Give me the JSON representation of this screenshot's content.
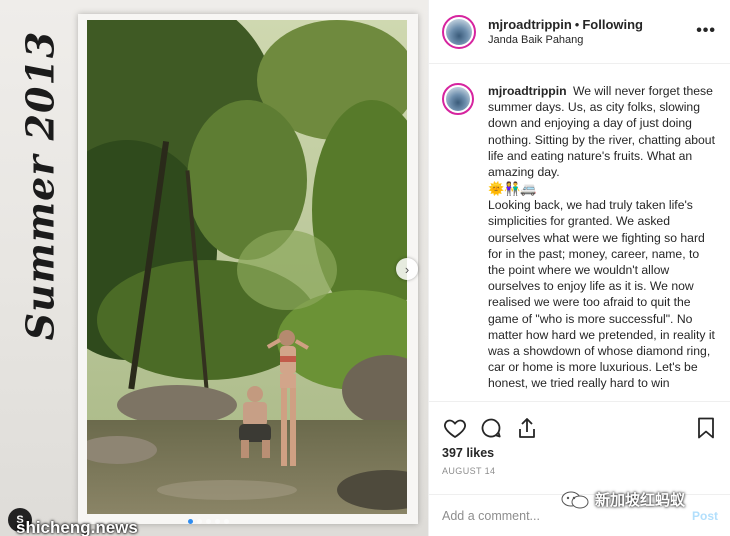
{
  "photo": {
    "handwriting": "Summer 2013",
    "carousel_dots": 5,
    "active_dot": 0,
    "watermark_logo": "S",
    "watermark_text": "shicheng.news"
  },
  "header": {
    "username": "mjroadtrippin",
    "separator": "•",
    "follow_status": "Following",
    "location": "Janda Baik Pahang",
    "more_icon": "more-horizontal-icon"
  },
  "caption": {
    "username": "mjroadtrippin",
    "text_part1": "We will never forget these summer days. Us, as city folks, slowing down and enjoying a day of just doing nothing. Sitting by the river, chatting about life and eating nature's fruits. What an amazing day.",
    "emojis": "🌞👫🚐",
    "text_part2": "Looking back, we had truly taken life's simplicities for granted. We asked ourselves what were we fighting so hard for in the past; money, career, name, to the point where we wouldn't allow ourselves to enjoy life as it is. We now realised we were too afraid to quit the game of \"who is more successful\". No matter how hard we pretended, in reality it was a showdown of whose diamond ring, car or home is more luxurious. Let's be honest, we tried really hard to win"
  },
  "actions": {
    "like_icon": "heart-icon",
    "comment_icon": "comment-icon",
    "share_icon": "share-icon",
    "save_icon": "bookmark-icon",
    "likes": "397 likes",
    "date": "AUGUST 14"
  },
  "comment_box": {
    "placeholder": "Add a comment...",
    "post_label": "Post"
  },
  "watermark_right": {
    "text": "新加坡红蚂蚁"
  },
  "colors": {
    "story_ring": "#d6249f",
    "post_button": "#b2dffc",
    "active_dot": "#2e8cf0"
  }
}
